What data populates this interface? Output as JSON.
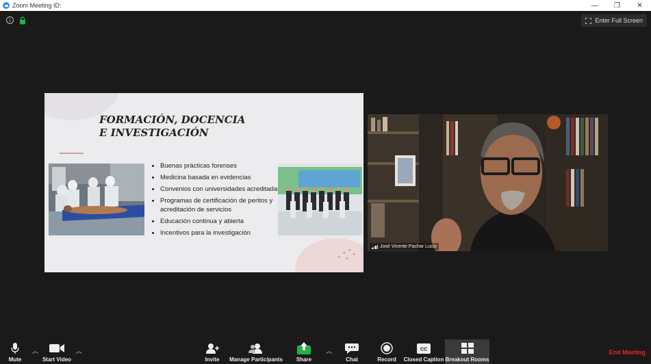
{
  "window": {
    "title": "Zoom Meeting ID:",
    "minimize": "—",
    "restore": "❐",
    "close": "✕"
  },
  "header": {
    "fullscreen_label": "Enter Full Screen"
  },
  "slide": {
    "title": "FORMACIÓN, DOCENCIA E INVESTIGACIÓN",
    "bullets": [
      "Buenas prácticas forenses",
      "Medicina basada en evidencias",
      "Convenios con universidades acreditadas",
      "Programas de certificación de peritos y acreditación de servicios",
      "Educación continua y abierta",
      "Incentivos para la investigación"
    ]
  },
  "video": {
    "participant_name": "José Vicente Pachar Lucio"
  },
  "toolbar": {
    "mute": "Mute",
    "start_video": "Start Video",
    "invite": "Invite",
    "manage_participants": "Manage Participants",
    "share": "Share",
    "chat": "Chat",
    "record": "Record",
    "closed_caption": "Closed Caption",
    "breakout_rooms": "Breakout Rooms",
    "end_meeting": "End Meeting"
  },
  "colors": {
    "accent_green": "#23b04b",
    "end_red": "#e02828",
    "zoom_blue": "#2d8cff"
  }
}
